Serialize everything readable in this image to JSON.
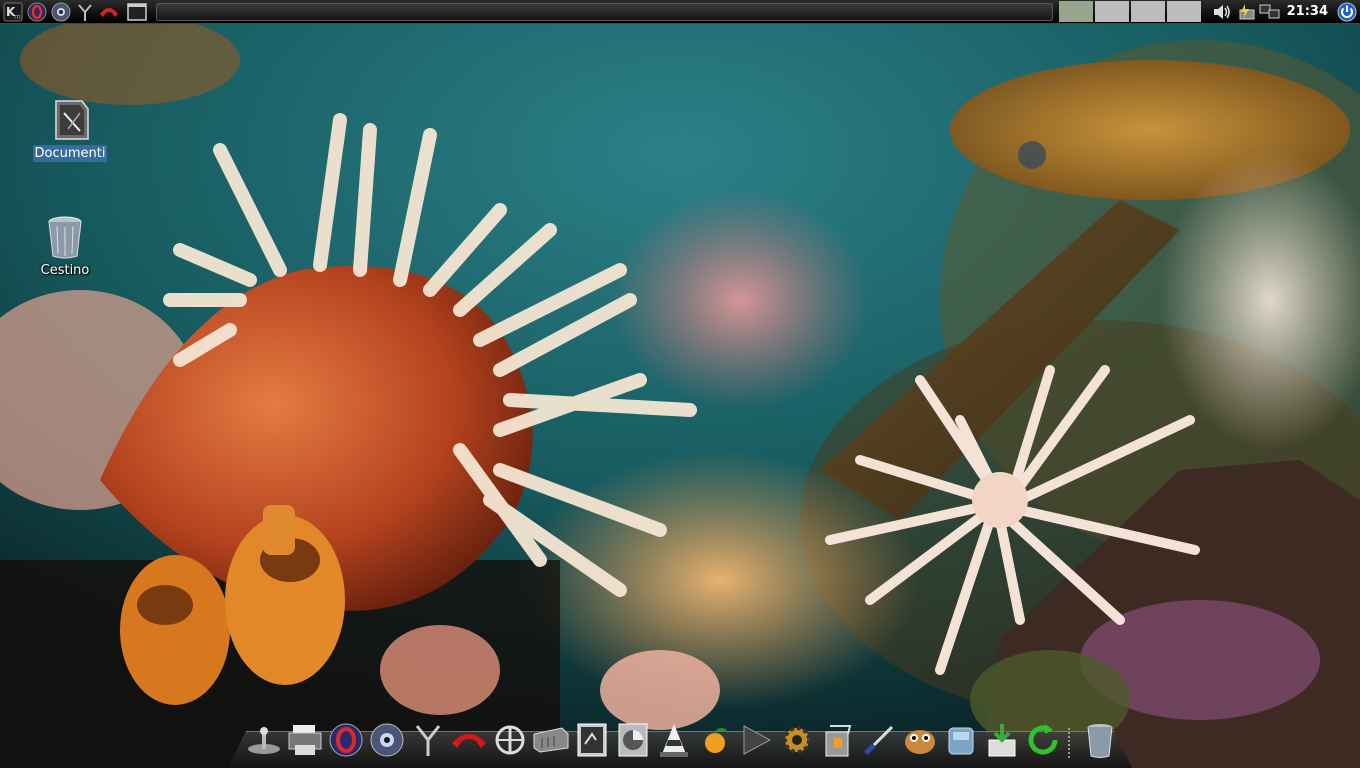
{
  "top_panel": {
    "launchers": [
      "kmenu-icon",
      "opera-icon",
      "eye-icon",
      "antenna-icon",
      "phone-icon",
      "show-desktop-icon"
    ],
    "pager": {
      "desktops": 4,
      "active_index": 0
    },
    "tray": [
      "volume-icon",
      "power-manager-icon",
      "network-icon"
    ],
    "clock": "21:34",
    "logout_icon": "power-icon"
  },
  "desktop_icons": [
    {
      "label": "Documenti",
      "icon": "documents-folder-icon",
      "selected": true
    },
    {
      "label": "Cestino",
      "icon": "trash-icon",
      "selected": false
    }
  ],
  "dock": {
    "items": [
      "joystick-icon",
      "printer-icon",
      "opera-icon",
      "eye-icon",
      "antenna-icon",
      "phone-icon",
      "steering-wheel-icon",
      "hard-disk-icon",
      "terminal-icon",
      "disk-utility-icon",
      "vlc-icon",
      "fruit-icon",
      "play-icon",
      "cogs-icon",
      "package-icon",
      "screwdriver-icon",
      "gimp-icon",
      "network-share-icon",
      "download-icon",
      "refresh-icon",
      "trash-icon"
    ]
  },
  "colors": {
    "panel": "#111111",
    "pager_active": "#96a58c",
    "pager_inactive": "#bdbdbd",
    "selection": "#3c6eaa"
  }
}
